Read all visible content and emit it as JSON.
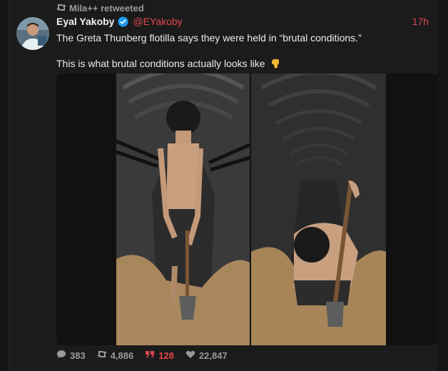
{
  "retweet": {
    "label": "Mila++ retweeted"
  },
  "tweet": {
    "display_name": "Eyal Yakoby",
    "handle": "@EYakoby",
    "time": "17h",
    "text_line_1": "The Greta Thunberg flotilla says they were held in “brutal conditions.”",
    "text_line_2": "This is what brutal conditions actually looks like"
  },
  "media": {
    "image_count": 2
  },
  "actions": {
    "replies": "383",
    "retweets": "4,886",
    "quotes": "128",
    "likes": "22,847"
  },
  "colors": {
    "accent": "#e0474c",
    "verified": "#1d9bf0",
    "background": "#1b1b1b",
    "muted_text": "#9a9a9a"
  }
}
